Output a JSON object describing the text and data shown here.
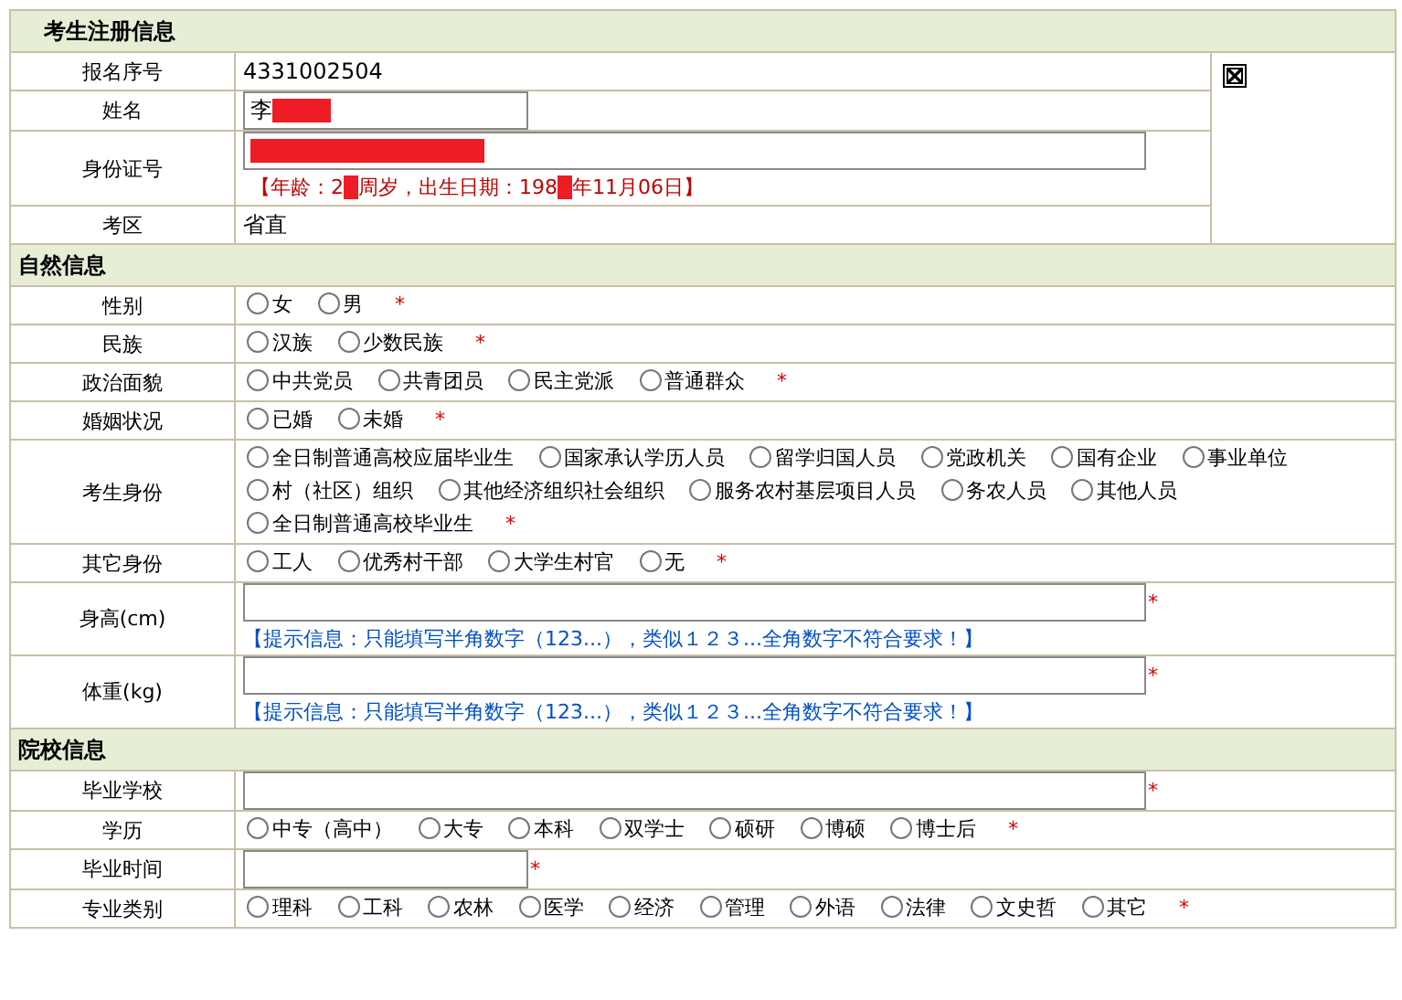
{
  "sections": [
    {
      "title": "考生注册信息",
      "has_photo": true,
      "rows": [
        {
          "label": "报名序号",
          "kind": "text",
          "value": "4331002504"
        },
        {
          "label": "姓名",
          "kind": "short-input",
          "value": "李",
          "redacted": true
        },
        {
          "label": "身份证号",
          "kind": "input",
          "value": "",
          "redacted": true,
          "note_parts": [
            "【年龄：2",
            "周岁，出生日期：198",
            "年11月06日】"
          ]
        },
        {
          "label": "考区",
          "kind": "text",
          "value": "省直"
        }
      ]
    },
    {
      "title": "自然信息",
      "has_photo": false,
      "rows": [
        {
          "label": "性别",
          "kind": "radios",
          "required_mark": "*",
          "options": [
            {
              "label": "女",
              "selected": false
            },
            {
              "label": "男",
              "selected": false
            }
          ]
        },
        {
          "label": "民族",
          "kind": "radios",
          "required_mark": "*",
          "options": [
            {
              "label": "汉族",
              "selected": false
            },
            {
              "label": "少数民族",
              "selected": false
            }
          ]
        },
        {
          "label": "政治面貌",
          "kind": "radios",
          "required_mark": "*",
          "options": [
            {
              "label": "中共党员",
              "selected": false
            },
            {
              "label": "共青团员",
              "selected": false
            },
            {
              "label": "民主党派",
              "selected": false
            },
            {
              "label": "普通群众",
              "selected": false
            }
          ]
        },
        {
          "label": "婚姻状况",
          "kind": "radios",
          "required_mark": "*",
          "options": [
            {
              "label": "已婚",
              "selected": false
            },
            {
              "label": "未婚",
              "selected": false
            }
          ]
        },
        {
          "label": "考生身份",
          "kind": "radios",
          "required_mark": "*",
          "options": [
            {
              "label": "全日制普通高校应届毕业生",
              "selected": false
            },
            {
              "label": "国家承认学历人员",
              "selected": false
            },
            {
              "label": "留学归国人员",
              "selected": false
            },
            {
              "label": "党政机关",
              "selected": false
            },
            {
              "label": "国有企业",
              "selected": false
            },
            {
              "label": "事业单位",
              "selected": false
            },
            {
              "label": "村（社区）组织",
              "selected": false
            },
            {
              "label": "其他经济组织社会组织",
              "selected": false
            },
            {
              "label": "服务农村基层项目人员",
              "selected": false
            },
            {
              "label": "务农人员",
              "selected": false
            },
            {
              "label": "其他人员",
              "selected": false
            },
            {
              "label": "全日制普通高校毕业生",
              "selected": false
            }
          ]
        },
        {
          "label": "其它身份",
          "kind": "radios",
          "required_mark": "*",
          "options": [
            {
              "label": "工人",
              "selected": false
            },
            {
              "label": "优秀村干部",
              "selected": false
            },
            {
              "label": "大学生村官",
              "selected": false
            },
            {
              "label": "无",
              "selected": false
            }
          ]
        },
        {
          "label": "身高(cm)",
          "kind": "input",
          "value": "",
          "required_mark": "*",
          "hint": "【提示信息：只能填写半角数字（123...），类似１２３...全角数字不符合要求！】"
        },
        {
          "label": "体重(kg)",
          "kind": "input",
          "value": "",
          "required_mark": "*",
          "hint": "【提示信息：只能填写半角数字（123...），类似１２３...全角数字不符合要求！】"
        }
      ]
    },
    {
      "title": "院校信息",
      "has_photo": false,
      "rows": [
        {
          "label": "毕业学校",
          "kind": "input",
          "value": "",
          "required_mark": "*"
        },
        {
          "label": "学历",
          "kind": "radios",
          "required_mark": "*",
          "options": [
            {
              "label": "中专（高中）",
              "selected": false
            },
            {
              "label": "大专",
              "selected": false
            },
            {
              "label": "本科",
              "selected": false
            },
            {
              "label": "双学士",
              "selected": false
            },
            {
              "label": "硕研",
              "selected": false
            },
            {
              "label": "博硕",
              "selected": false
            },
            {
              "label": "博士后",
              "selected": false
            }
          ]
        },
        {
          "label": "毕业时间",
          "kind": "short-input",
          "value": "",
          "required_mark": "*"
        },
        {
          "label": "专业类别",
          "kind": "radios",
          "required_mark": "*",
          "options": [
            {
              "label": "理科",
              "selected": false
            },
            {
              "label": "工科",
              "selected": false
            },
            {
              "label": "农林",
              "selected": false
            },
            {
              "label": "医学",
              "selected": false
            },
            {
              "label": "经济",
              "selected": false
            },
            {
              "label": "管理",
              "selected": false
            },
            {
              "label": "外语",
              "selected": false
            },
            {
              "label": "法律",
              "selected": false
            },
            {
              "label": "文史哲",
              "selected": false
            },
            {
              "label": "其它",
              "selected": false
            }
          ]
        }
      ]
    }
  ]
}
